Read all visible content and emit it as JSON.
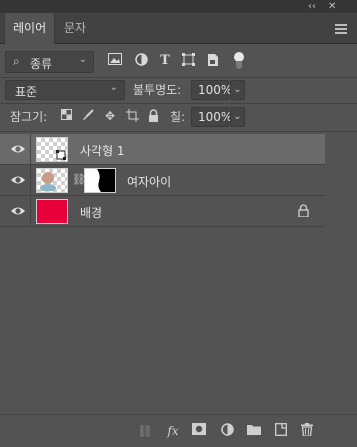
{
  "tabs": [
    {
      "label": "레이어",
      "active": true
    },
    {
      "label": "문자",
      "active": false
    }
  ],
  "filter": {
    "label": "종류",
    "icons": [
      "image-filter-icon",
      "adjustment-filter-icon",
      "type-filter-icon",
      "shape-filter-icon",
      "smart-object-filter-icon"
    ]
  },
  "blend_mode": "표준",
  "opacity": {
    "label": "불투명도:",
    "value": "100%"
  },
  "lock": {
    "label": "잠그기:",
    "icons": [
      "lock-transparent-icon",
      "lock-paint-icon",
      "lock-move-icon",
      "lock-artboard-icon",
      "lock-all-icon"
    ]
  },
  "fill": {
    "label": "칠:",
    "value": "100%"
  },
  "layers": [
    {
      "name": "사각형 1",
      "selected": true,
      "type": "shape"
    },
    {
      "name": "여자아이",
      "selected": false,
      "type": "masked-image"
    },
    {
      "name": "배경",
      "selected": false,
      "type": "background",
      "color": "#e8003a",
      "locked": true
    }
  ],
  "bottom_icons": [
    "link-layers-icon",
    "fx-icon",
    "add-mask-icon",
    "adjustment-layer-icon",
    "new-group-icon",
    "new-layer-icon",
    "delete-icon"
  ],
  "colors": {
    "panel": "#535353",
    "selected_row": "#6a6a6a",
    "background_fill": "#e8003a"
  }
}
